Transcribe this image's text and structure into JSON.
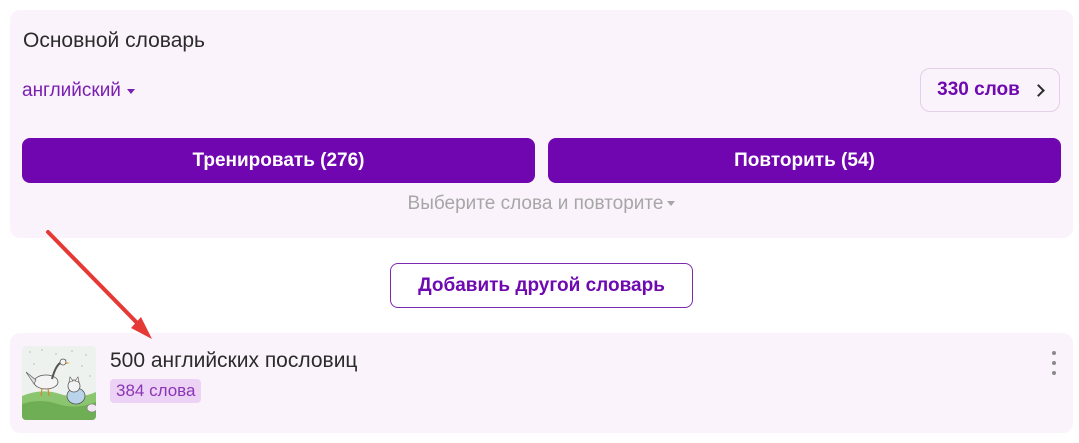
{
  "main_dictionary": {
    "title": "Основной словарь",
    "language": "английский",
    "words_count_label": "330 слов",
    "train_button": "Тренировать (276)",
    "repeat_button": "Повторить (54)",
    "select_hint": "Выберите слова и повторите"
  },
  "add_dictionary_button": "Добавить другой словарь",
  "dictionaries": [
    {
      "name": "500 английских пословиц",
      "count_label": "384 слова"
    }
  ],
  "icons": {
    "language_caret": "caret-down-icon",
    "words_chevron": "chevron-right-icon",
    "hint_caret": "caret-down-icon",
    "menu": "more-vertical-icon",
    "annotation": "red-arrow-icon"
  },
  "colors": {
    "accent": "#6f06b0",
    "card_bg": "#fbf3fb",
    "badge_bg": "#ecd2f5",
    "annotation_arrow": "#e53935"
  }
}
